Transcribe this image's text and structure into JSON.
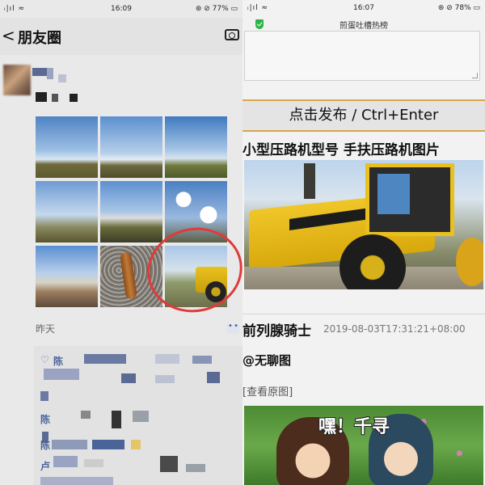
{
  "left": {
    "status": {
      "signal": "ᵢ|ıl ≈",
      "time": "16:09",
      "battery": "⊛ ⊘ 77% ▭"
    },
    "header": {
      "back": "<",
      "title": "朋友圈"
    },
    "post": {
      "date_label": "昨天"
    },
    "comments": [
      {
        "text": "陈",
        "prefix": "♡"
      },
      {
        "text": "陈",
        "prefix": ""
      },
      {
        "text": "陈",
        "prefix": ""
      },
      {
        "text": "卢",
        "prefix": ""
      }
    ]
  },
  "right": {
    "status": {
      "signal": "ᵢ|ıl ≈",
      "time": "16:07",
      "battery": "⊛ ⊘ 78% ▭"
    },
    "title": "煎蛋吐槽热榜",
    "submit_label": "点击发布 / Ctrl+Enter",
    "post1_title": "小型压路机型号 手扶压路机图片",
    "post2": {
      "author": "前列腺骑士",
      "datetime": "2019-08-03T17:31:21+08:00",
      "title": "@无聊图",
      "link": "[查看原图]",
      "gif_caption": "嘿！千寻"
    }
  },
  "colors": {
    "link_blue": "#4a6399",
    "circle_red": "#e03a3a",
    "divider_gold": "#d9a74a"
  }
}
